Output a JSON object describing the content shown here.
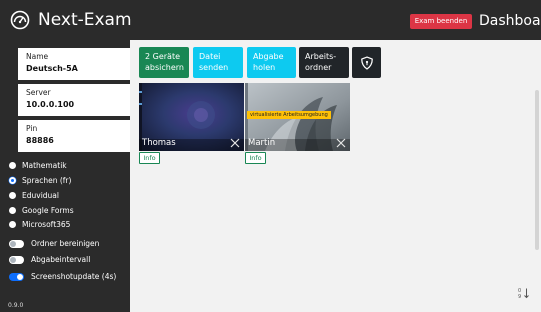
{
  "app": {
    "title": "Next-Exam",
    "end_exam_label": "Exam beenden",
    "page_title": "Dashboard",
    "version": "0.9.0"
  },
  "exam": {
    "name_label": "Name",
    "name_value": "Deutsch-5A",
    "server_label": "Server",
    "server_value": "10.0.0.100",
    "pin_label": "Pin",
    "pin_value": "88886"
  },
  "modes": {
    "items": [
      {
        "label": "Mathematik",
        "checked": false
      },
      {
        "label": "Sprachen (fr)",
        "checked": true
      },
      {
        "label": "Eduvidual",
        "checked": false
      },
      {
        "label": "Google Forms",
        "checked": false
      },
      {
        "label": "Microsoft365",
        "checked": false
      }
    ]
  },
  "toggles": {
    "items": [
      {
        "label": "Ordner bereinigen",
        "on": false
      },
      {
        "label": "Abgabeintervall",
        "on": false
      },
      {
        "label": "Screenshotupdate (4s)",
        "on": true
      }
    ]
  },
  "toolbar": {
    "secure_label_1": "2 Geräte",
    "secure_label_2": "absichern",
    "send_label_1": "Datei",
    "send_label_2": "senden",
    "fetch_label_1": "Abgabe",
    "fetch_label_2": "holen",
    "folder_label_1": "Arbeits-",
    "folder_label_2": "ordner"
  },
  "students": [
    {
      "name": "Thomas",
      "info_label": "Info",
      "virtual_badge": ""
    },
    {
      "name": "Martin",
      "info_label": "Info",
      "virtual_badge": "virtualisierte Arbeitsumgebung"
    }
  ],
  "colors": {
    "background": "#2b2b2b",
    "danger": "#dc3545",
    "success": "#198754",
    "info": "#0dcaf0",
    "primary": "#0d6efd",
    "warning": "#ffc107"
  },
  "icons": {
    "logo": "gauge-icon",
    "shield": "shield-icon",
    "close": "close-icon",
    "sort": "sort-numeric-icon"
  }
}
